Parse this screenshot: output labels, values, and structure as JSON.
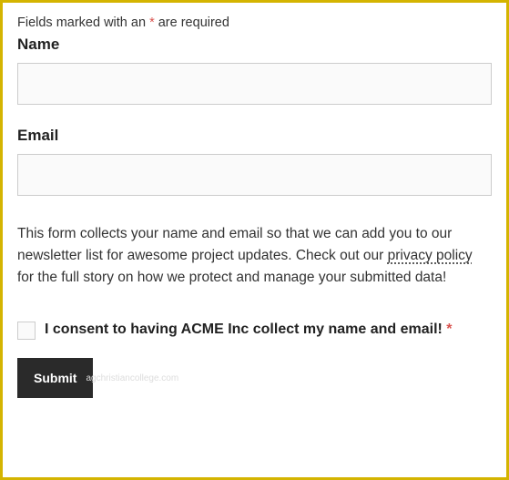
{
  "form": {
    "required_notice_prefix": "Fields marked with an ",
    "required_notice_suffix": " are required",
    "asterisk": "*",
    "name_label": "Name",
    "name_value": "",
    "email_label": "Email",
    "email_value": "",
    "description_part1": "This form collects your name and email so that we can add you to our newsletter list for awesome project updates. Check out our ",
    "privacy_link_text": "privacy policy",
    "description_part2": " for the full story on how we protect and manage your submitted data!",
    "consent_label": "I consent to having ACME Inc collect my name and email! ",
    "consent_checked": false,
    "submit_label": "Submit",
    "watermark": "agchristiancollege.com"
  }
}
